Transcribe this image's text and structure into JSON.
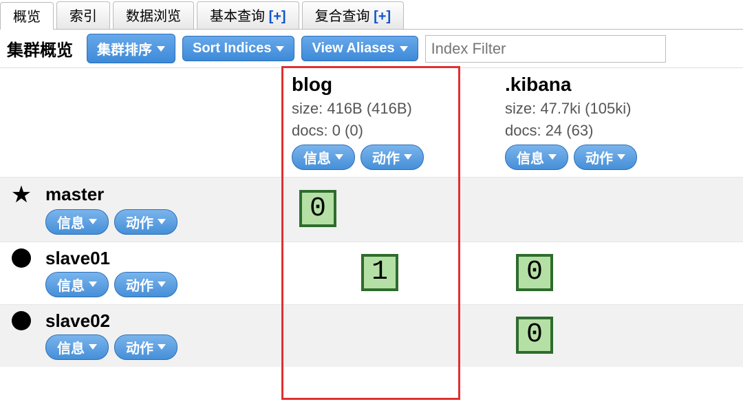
{
  "tabs": [
    {
      "label": "概览",
      "active": true,
      "plus": false
    },
    {
      "label": "索引",
      "active": false,
      "plus": false
    },
    {
      "label": "数据浏览",
      "active": false,
      "plus": false
    },
    {
      "label": "基本查询",
      "active": false,
      "plus": true
    },
    {
      "label": "复合查询",
      "active": false,
      "plus": true
    }
  ],
  "plus_glyph": "[+]",
  "toolbar": {
    "title": "集群概览",
    "sort_cluster": "集群排序",
    "sort_indices": "Sort Indices",
    "view_aliases": "View Aliases",
    "filter_placeholder": "Index Filter"
  },
  "common_buttons": {
    "info": "信息",
    "action": "动作"
  },
  "indices": [
    {
      "name": "blog",
      "size_line": "size: 416B (416B)",
      "docs_line": "docs: 0 (0)"
    },
    {
      "name": ".kibana",
      "size_line": "size: 47.7ki (105ki)",
      "docs_line": "docs: 24 (63)"
    }
  ],
  "nodes": [
    {
      "name": "master",
      "icon": "star",
      "shards": {
        "blog": "0",
        "blog_pos": "left",
        "kibana": null
      }
    },
    {
      "name": "slave01",
      "icon": "dot",
      "shards": {
        "blog": "1",
        "blog_pos": "right",
        "kibana": "0"
      }
    },
    {
      "name": "slave02",
      "icon": "dot",
      "shards": {
        "blog": null,
        "kibana": "0"
      }
    }
  ]
}
